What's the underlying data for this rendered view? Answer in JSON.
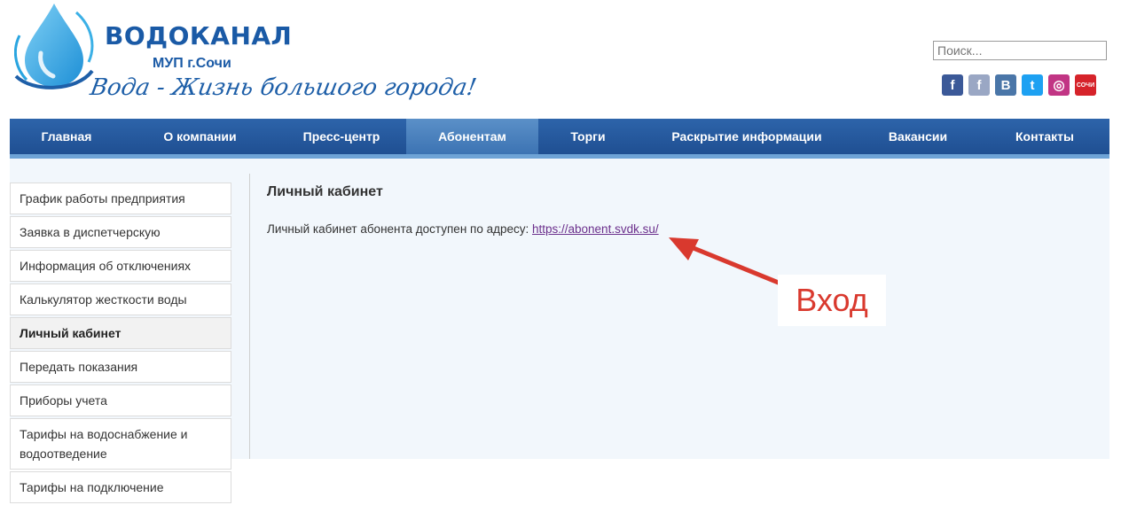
{
  "brand": {
    "title": "ВОДОКАНАЛ",
    "subtitle": "МУП г.Сочи",
    "slogan": "Вода - Жизнь большого города!"
  },
  "search": {
    "placeholder": "Поиск..."
  },
  "socials": [
    {
      "name": "facebook-icon",
      "label": "f",
      "color": "#3b5998"
    },
    {
      "name": "facebook-alt-icon",
      "label": "f",
      "color": "#9aa7c4"
    },
    {
      "name": "vk-icon",
      "label": "B",
      "color": "#4a76a8"
    },
    {
      "name": "twitter-icon",
      "label": "t",
      "color": "#1da1f2"
    },
    {
      "name": "instagram-icon",
      "label": "◎",
      "color": "#c13584"
    },
    {
      "name": "sochi-logo-icon",
      "label": "СОЧИ",
      "color": "#d6232a"
    }
  ],
  "nav": {
    "items": [
      {
        "label": "Главная"
      },
      {
        "label": "О компании"
      },
      {
        "label": "Пресс-центр"
      },
      {
        "label": "Абонентам"
      },
      {
        "label": "Торги"
      },
      {
        "label": "Раскрытие информации"
      },
      {
        "label": "Вакансии"
      },
      {
        "label": "Контакты"
      }
    ],
    "active_label": "Абонентам"
  },
  "sidebar": {
    "items": [
      {
        "label": "График работы предприятия"
      },
      {
        "label": "Заявка в диспетчерскую"
      },
      {
        "label": "Информация об отключениях"
      },
      {
        "label": "Калькулятор жесткости воды"
      },
      {
        "label": "Личный кабинет"
      },
      {
        "label": "Передать показания"
      },
      {
        "label": "Приборы учета"
      },
      {
        "label": "Тарифы на водоснабжение и водоотведение"
      },
      {
        "label": "Тарифы на подключение"
      }
    ],
    "active_label": "Личный кабинет"
  },
  "main": {
    "title": "Личный кабинет",
    "info_text": "Личный кабинет абонента доступен по адресу: ",
    "link_text": "https://abonent.svdk.su/"
  },
  "annotation": {
    "callout_text": "Вход",
    "color": "#d9392e"
  }
}
